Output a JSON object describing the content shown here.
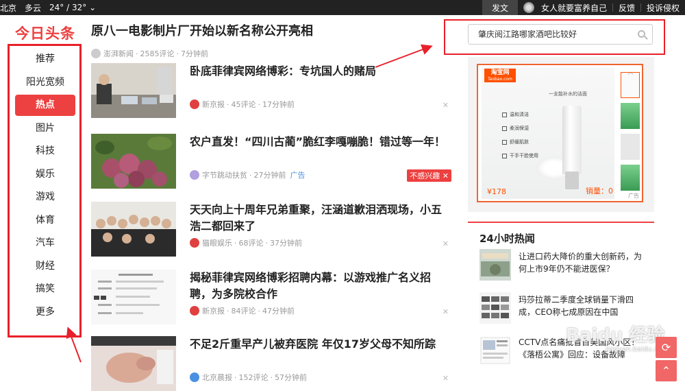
{
  "topbar": {
    "city": "北京",
    "weather": "多云",
    "temp": "24° / 32°",
    "post_label": "发文",
    "username": "女人就要富养自己",
    "feedback_label": "反馈",
    "report_label": "投诉侵权"
  },
  "logo": "今日头条",
  "nav": {
    "items": [
      "推荐",
      "阳光宽频",
      "热点",
      "图片",
      "科技",
      "娱乐",
      "游戏",
      "体育",
      "汽车",
      "财经",
      "搞笑",
      "更多"
    ],
    "active": "热点"
  },
  "headline": {
    "title": "原八一电影制片厂开始以新名称公开亮相",
    "source": "澎湃新闻",
    "comments": "2585评论",
    "time": "7分钟前"
  },
  "feed": [
    {
      "title": "卧底菲律宾网络博彩：专坑国人的赌局",
      "source": "新京报",
      "comments": "45评论",
      "time": "17分钟前",
      "ad": "",
      "thumb": "people-laptops",
      "source_color": "#e04040"
    },
    {
      "title": "农户直发！“四川古蔺”脆红李嘎嘣脆！错过等一年！",
      "source": "字节跳动扶贫",
      "comments": "",
      "time": "27分钟前",
      "ad": "广告",
      "nointerest": "不感兴趣",
      "thumb": "plums",
      "source_color": "#b0a0e0"
    },
    {
      "title": "天天向上十周年兄弟重聚，汪涵道歉泪洒现场，小五浩二都回来了",
      "source": "猫眼娱乐",
      "comments": "68评论",
      "time": "37分钟前",
      "ad": "",
      "thumb": "group-photo",
      "source_color": "#e04040"
    },
    {
      "title": "揭秘菲律宾网络博彩招聘内幕：以游戏推广名义招聘，为多院校合作",
      "source": "新京报",
      "comments": "84评论",
      "time": "47分钟前",
      "ad": "",
      "thumb": "document",
      "source_color": "#e04040"
    },
    {
      "title": "不足2斤重早产儿被弃医院 年仅17岁父母不知所踪",
      "source": "北京晨报",
      "comments": "152评论",
      "time": "57分钟前",
      "ad": "",
      "thumb": "baby",
      "source_color": "#4a90e2"
    }
  ],
  "search": {
    "value": "肇庆阅江路哪家酒吧比较好"
  },
  "ad": {
    "logo_text": "淘宝网",
    "logo_sub": "Taobao.com",
    "product_title": "一支能补水的洁面",
    "features": [
      "温和清洁",
      "柔润保湿",
      "舒缓肌肤",
      "干手干脸使用"
    ],
    "price": "¥178",
    "sales": "销量：0",
    "corner": "广告"
  },
  "hot": {
    "title": "24小时热闻",
    "items": [
      {
        "text": "让进口药大降价的重大创新药，为何上市9年仍不能进医保？"
      },
      {
        "text": "玛莎拉蒂二季度全球销量下滑四成，CEO称七成原因在中国"
      },
      {
        "text": "CCTV点名痛批盲目美国风小区！《落梧公寓》回应：设备故障"
      }
    ]
  },
  "watermark": "Baidu 经验",
  "watermark_sub": "jingyan.baidu.com",
  "colors": {
    "brand_red": "#ed4040",
    "annotation_red": "#e8202a",
    "taobao_orange": "#ff5000",
    "topbar_bg": "#222222"
  }
}
